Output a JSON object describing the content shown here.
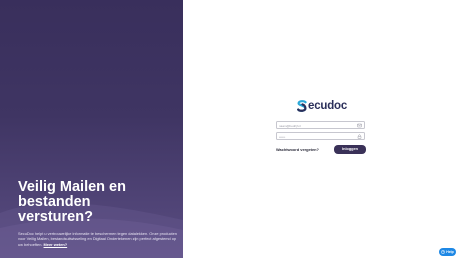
{
  "hero": {
    "headline": "Veilig Mailen en\nbestanden\nversturen?",
    "description": "SecuDoc helpt u vertrouwelijke informatie te beschermen tegen datalekken. Onze producten voor Veilig Mailen, bestandsuitwisseling en Digitaal Ondertekenen zijn perfect afgestemd op uw behoeften.",
    "more_link": "Meer weten?"
  },
  "brand": {
    "name": "ecudoc",
    "accent": "#2aa8d8",
    "dark": "#2b2f5a"
  },
  "login": {
    "email_placeholder": "naam@bedrijf.nl",
    "password_placeholder": "••••••",
    "forgot_link": "Wachtwoord vergeten?",
    "submit_label": "Inloggen"
  },
  "help": {
    "label": "Help",
    "icon": "question-icon"
  },
  "colors": {
    "panel": "#3f3563",
    "button": "#3a3158",
    "help": "#1e88e5"
  }
}
